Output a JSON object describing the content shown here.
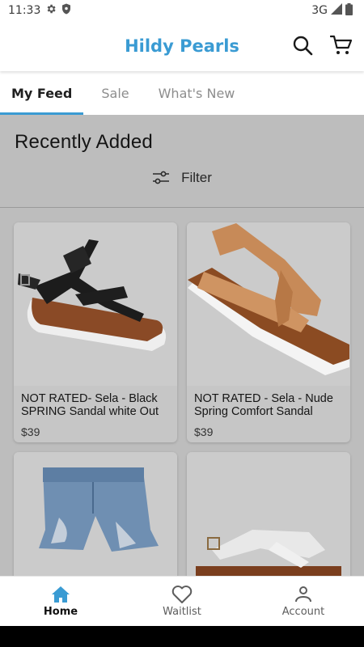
{
  "status_bar": {
    "time": "11:33",
    "network": "3G"
  },
  "app_bar": {
    "title": "Hildy Pearls"
  },
  "tabs": [
    {
      "label": "My Feed",
      "active": true
    },
    {
      "label": "Sale",
      "active": false
    },
    {
      "label": "What's New",
      "active": false
    }
  ],
  "feed": {
    "title": "Recently Added",
    "filter_label": "Filter",
    "products": [
      {
        "name": "NOT RATED- Sela - Black SPRING Sandal white Out",
        "price": "$39",
        "image": "black-strappy-sandal"
      },
      {
        "name": "NOT RATED - Sela - Nude Spring Comfort Sandal",
        "price": "$39",
        "image": "nude-braided-sandal"
      },
      {
        "name": "",
        "price": "",
        "image": "denim-shorts"
      },
      {
        "name": "",
        "price": "",
        "image": "white-strap-sandal"
      }
    ]
  },
  "bottom_nav": [
    {
      "label": "Home",
      "icon": "home-icon",
      "active": true
    },
    {
      "label": "Waitlist",
      "icon": "heart-icon",
      "active": false
    },
    {
      "label": "Account",
      "icon": "account-icon",
      "active": false
    }
  ],
  "colors": {
    "brand": "#3a9bd3",
    "overlay": "#bdbdbd"
  }
}
